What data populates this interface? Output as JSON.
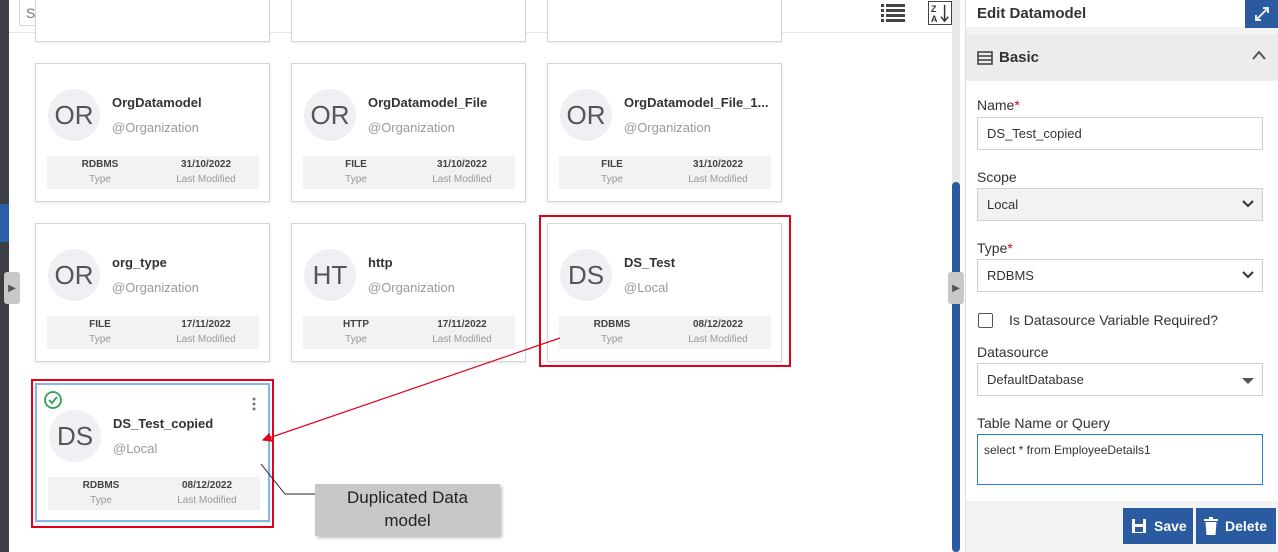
{
  "toolbar": {
    "search_placeholder": "Search"
  },
  "cards": [
    {
      "initials": "OR",
      "title": "OrgDatamodel",
      "scope": "@Organization",
      "type": "RDBMS",
      "type_label": "Type",
      "modified": "31/10/2022",
      "modified_label": "Last Modified"
    },
    {
      "initials": "OR",
      "title": "OrgDatamodel_File",
      "scope": "@Organization",
      "type": "FILE",
      "type_label": "Type",
      "modified": "31/10/2022",
      "modified_label": "Last Modified"
    },
    {
      "initials": "OR",
      "title": "OrgDatamodel_File_1...",
      "scope": "@Organization",
      "type": "FILE",
      "type_label": "Type",
      "modified": "31/10/2022",
      "modified_label": "Last Modified"
    },
    {
      "initials": "OR",
      "title": "org_type",
      "scope": "@Organization",
      "type": "FILE",
      "type_label": "Type",
      "modified": "17/11/2022",
      "modified_label": "Last Modified"
    },
    {
      "initials": "HT",
      "title": "http",
      "scope": "@Organization",
      "type": "HTTP",
      "type_label": "Type",
      "modified": "17/11/2022",
      "modified_label": "Last Modified"
    },
    {
      "initials": "DS",
      "title": "DS_Test",
      "scope": "@Local",
      "type": "RDBMS",
      "type_label": "Type",
      "modified": "08/12/2022",
      "modified_label": "Last Modified"
    },
    {
      "initials": "DS",
      "title": "DS_Test_copied",
      "scope": "@Local",
      "type": "RDBMS",
      "type_label": "Type",
      "modified": "08/12/2022",
      "modified_label": "Last Modified"
    }
  ],
  "annotation": {
    "callout_line1": "Duplicated Data",
    "callout_line2": "model"
  },
  "panel": {
    "title": "Edit Datamodel",
    "section_title": "Basic",
    "name_label": "Name",
    "name_value": "DS_Test_copied",
    "scope_label": "Scope",
    "scope_value": "Local",
    "type_label": "Type",
    "type_value": "RDBMS",
    "required_mark": "*",
    "checkbox_label": "Is Datasource Variable Required?",
    "datasource_label": "Datasource",
    "datasource_value": "DefaultDatabase",
    "query_label": "Table Name or Query",
    "query_value": "select * from EmployeeDetails1",
    "save_label": "Save",
    "delete_label": "Delete"
  },
  "colors": {
    "accent": "#2a5ba0",
    "annotation_red": "#e2001a",
    "success_green": "#2e9e5b"
  }
}
